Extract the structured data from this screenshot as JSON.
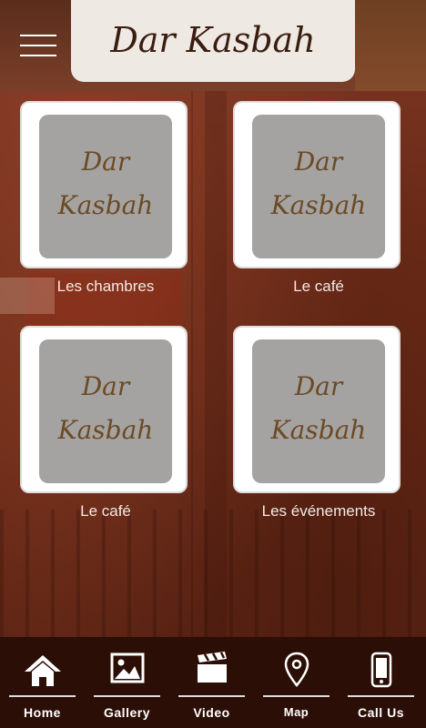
{
  "header": {
    "logo": "Dar Kasbah",
    "menu_icon": "hamburger-menu-icon"
  },
  "tiles": [
    {
      "logo_line1": "Dar",
      "logo_line2": "Kasbah",
      "label": "Les chambres"
    },
    {
      "logo_line1": "Dar",
      "logo_line2": "Kasbah",
      "label": "Le café"
    },
    {
      "logo_line1": "Dar",
      "logo_line2": "Kasbah",
      "label": "Le café"
    },
    {
      "logo_line1": "Dar",
      "logo_line2": "Kasbah",
      "label": "Les événements"
    }
  ],
  "nav": {
    "items": [
      {
        "label": "Home",
        "icon": "home-icon"
      },
      {
        "label": "Gallery",
        "icon": "image-icon"
      },
      {
        "label": "Video",
        "icon": "clapperboard-icon"
      },
      {
        "label": "Map",
        "icon": "map-pin-icon"
      },
      {
        "label": "Call Us",
        "icon": "phone-icon"
      }
    ]
  },
  "colors": {
    "nav_bg": "#2b0e05",
    "logo_box": "#efe9e3",
    "tile_inner": "#a5a3a2",
    "logo_brown": "#6b4a24"
  }
}
